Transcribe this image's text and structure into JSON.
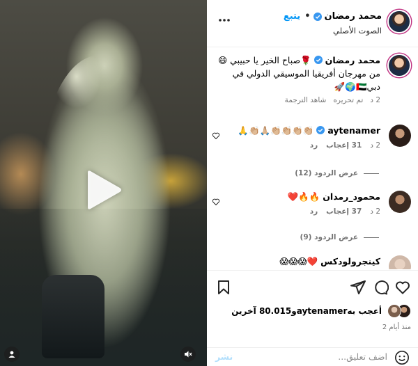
{
  "header": {
    "username": "محمد رمضان",
    "follow_label": "يتبع",
    "subtitle": "الصوت الأصلي",
    "more_icon": "more-horizontal-icon"
  },
  "caption": {
    "username": "محمد رمضان",
    "line1": "🌹صباح الخير يا حبيبي 😄",
    "line2": "من مهرجان أفريقيا الموسيقي الدولي في",
    "line3": "دبي🇦🇪🌍🚀",
    "time": "2 د",
    "edited_label": "تم تحريره",
    "translation_label": "شاهد الترجمة"
  },
  "comments": [
    {
      "username": "aytenamer",
      "verified": true,
      "text": "👏🏼👏🏼👏🏼👏🏼🙏🏼👏🏼🙏",
      "time": "2 د",
      "likes": "31 إعجاب",
      "reply": "رد",
      "view_replies": "عرض الردود (12)"
    },
    {
      "username": "محمود_رمدان",
      "verified": false,
      "text": "🔥🔥❤️",
      "time": "2 د",
      "likes": "37 إعجاب",
      "reply": "رد",
      "view_replies": "عرض الردود (9)"
    },
    {
      "username": "كينجرولودكس",
      "verified": false,
      "text": "❤️😱😱😱"
    }
  ],
  "likes": {
    "text": "أعجب بهaytenamerو80.015 آخرين"
  },
  "time_ago": "منذ أيام 2",
  "comment_box": {
    "placeholder": "اضف تعليق...",
    "post_label": "نشر"
  },
  "colors": {
    "accent": "#0095f6",
    "verified": "#3897f0",
    "heart_outline": "#262626",
    "muted": "#737373"
  },
  "icons": [
    "play-icon",
    "heart-icon",
    "comment-icon",
    "share-icon",
    "bookmark-icon",
    "emoji-icon",
    "verified-icon",
    "more-horizontal-icon",
    "mute-icon",
    "user-tag-icon"
  ]
}
